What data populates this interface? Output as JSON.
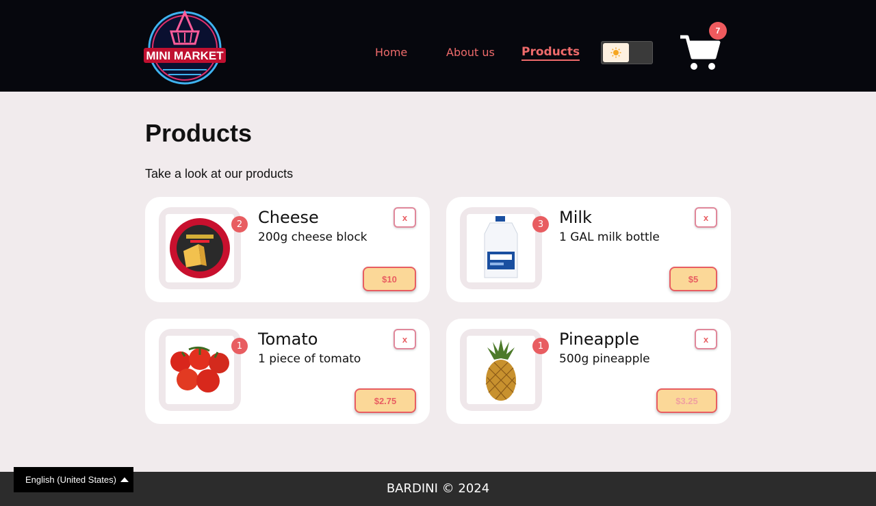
{
  "header": {
    "logo_text": "MINI MARKET",
    "nav": {
      "home": "Home",
      "about": "About us",
      "products": "Products"
    },
    "theme_toggle": {
      "icon": "sun-icon",
      "state": "light"
    },
    "cart": {
      "icon": "cart-icon",
      "count": "7"
    }
  },
  "main": {
    "title": "Products",
    "subtitle": "Take a look at our products",
    "products": [
      {
        "name": "Cheese",
        "description": "200g cheese block",
        "quantity": "2",
        "price": "$10",
        "remove": "x"
      },
      {
        "name": "Milk",
        "description": "1 GAL milk bottle",
        "quantity": "3",
        "price": "$5",
        "remove": "x"
      },
      {
        "name": "Tomato",
        "description": "1 piece of tomato",
        "quantity": "1",
        "price": "$2.75",
        "remove": "x"
      },
      {
        "name": "Pineapple",
        "description": "500g pineapple",
        "quantity": "1",
        "price": "$3.25",
        "remove": "x"
      }
    ]
  },
  "footer": {
    "copyright": "BARDINI © 2024",
    "language": "English (United States)"
  },
  "colors": {
    "header_bg": "#06070d",
    "accent": "#ef6b6b",
    "badge": "#e85d61",
    "price_bg": "#fbd898",
    "page_bg": "#f1ebed",
    "footer_bg": "#2c2c2c"
  }
}
